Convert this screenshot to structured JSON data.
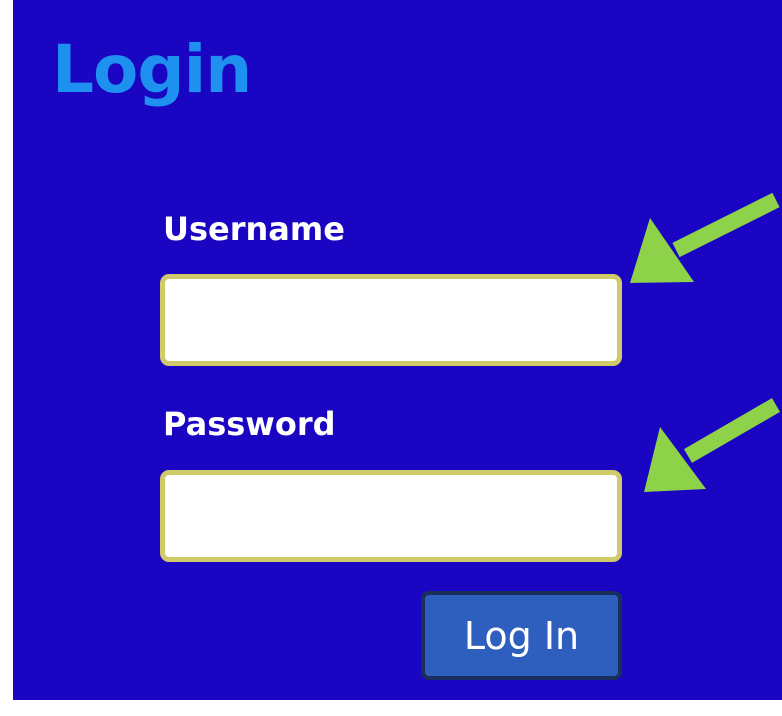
{
  "login": {
    "title": "Login",
    "username_label": "Username",
    "username_value": "",
    "password_label": "Password",
    "password_value": "",
    "submit_label": "Log In"
  },
  "annotations": {
    "arrow_color": "#8ed24a",
    "arrows": [
      "arrow-icon",
      "arrow-icon"
    ]
  },
  "colors": {
    "background": "#1a05c2",
    "title": "#1e90f0",
    "input_border": "#cfca6a",
    "button": "#2f5fbe"
  }
}
